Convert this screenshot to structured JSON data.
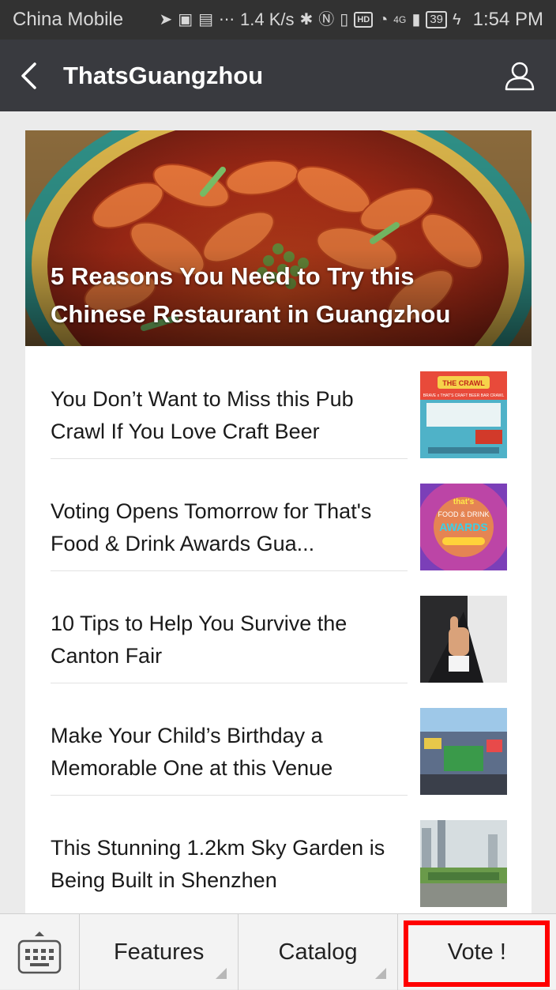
{
  "status_bar": {
    "carrier": "China Mobile",
    "speed": "1.4 K/s",
    "network": "4G",
    "battery": "39",
    "time": "1:54 PM"
  },
  "header": {
    "title": "ThatsGuangzhou"
  },
  "hero": {
    "title": "5 Reasons You Need to Try this Chinese Restaurant in Guangzhou"
  },
  "articles": [
    {
      "title": "You Don’t Want to Miss this Pub Crawl If You Love Craft Beer"
    },
    {
      "title": "Voting Opens Tomorrow for That's Food & Drink Awards Gua..."
    },
    {
      "title": "10 Tips to Help You Survive the Canton Fair"
    },
    {
      "title": "Make Your Child’s Birthday a Memorable One at this Venue"
    },
    {
      "title": "This Stunning 1.2km Sky Garden is Being Built in Shenzhen"
    }
  ],
  "thumb_text": {
    "crawl_top": "THE CRAWL",
    "crawl_sub": "BRAVE x THAT'S CRAFT BEER BAR CRAWL",
    "awards_top": "that's",
    "awards_mid": "FOOD & DRINK",
    "awards_main": "AWARDS"
  },
  "bottom_menu": {
    "features": "Features",
    "catalog": "Catalog",
    "vote": "Vote !"
  },
  "colors": {
    "title_bar": "#393a3f",
    "status_bar": "#323232",
    "highlight": "#ff0000"
  }
}
